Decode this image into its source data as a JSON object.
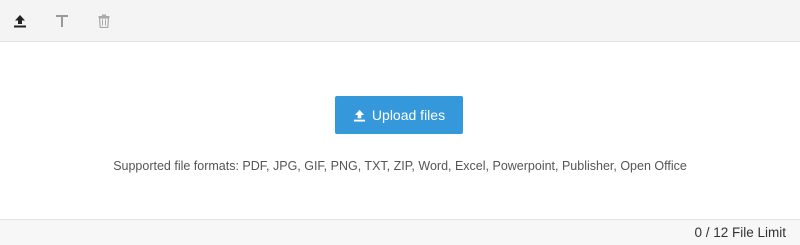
{
  "toolbar": {
    "icons": [
      "upload-icon",
      "text-icon",
      "trash-icon"
    ]
  },
  "main": {
    "upload_button_label": "Upload files",
    "supported_formats": "Supported file formats: PDF, JPG, GIF, PNG, TXT, ZIP, Word, Excel, Powerpoint, Publisher, Open Office"
  },
  "footer": {
    "file_count": "0",
    "file_limit_max": "12",
    "file_limit_text": "0 / 12 File Limit"
  },
  "colors": {
    "accent": "#3498db",
    "toolbar_bg": "#f4f4f4",
    "icon_active": "#222222",
    "icon_disabled": "#999999"
  }
}
